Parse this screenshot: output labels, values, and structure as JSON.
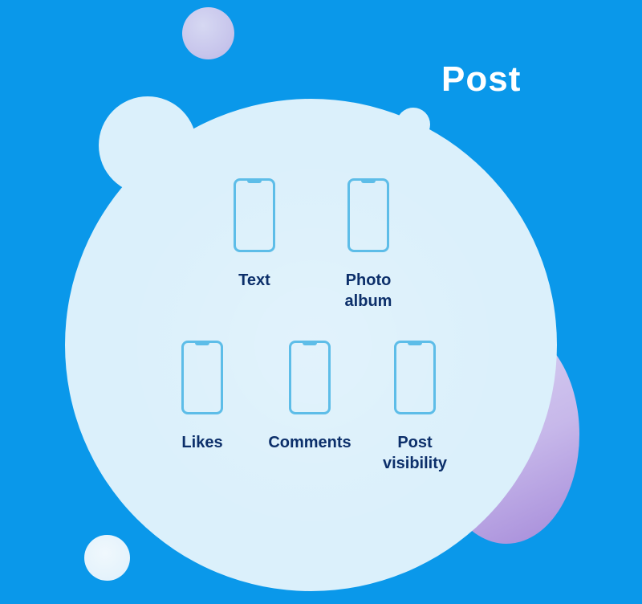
{
  "header": {
    "title": "Post"
  },
  "features": [
    {
      "label": "Text",
      "icon": "phone-icon"
    },
    {
      "label": "Photo\nalbum",
      "icon": "phone-icon"
    },
    {
      "label": "Likes",
      "icon": "phone-icon"
    },
    {
      "label": "Comments",
      "icon": "phone-icon"
    },
    {
      "label": "Post\nvisibility",
      "icon": "phone-icon"
    }
  ],
  "colors": {
    "background": "#0a98ea",
    "bubble": "#dbf0fb",
    "accent_purple": "#a58ad9",
    "icon_stroke": "#5dbde8",
    "label_text": "#0c2f6a",
    "title_text": "#ffffff"
  }
}
